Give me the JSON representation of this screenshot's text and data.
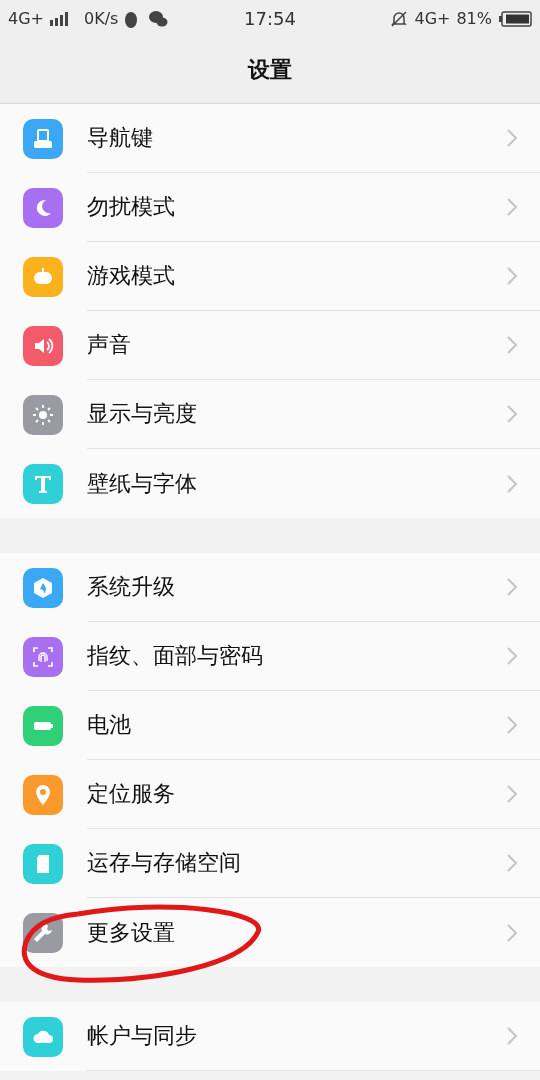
{
  "status_bar": {
    "network": "4G+",
    "speed": "0K/s",
    "time": "17:54",
    "network_right": "4G+",
    "battery": "81%"
  },
  "header": {
    "title": "设置"
  },
  "sections": [
    {
      "items": [
        {
          "label": "导航键",
          "kind": "nav",
          "color": "#3aa8f5",
          "circled": false
        },
        {
          "label": "勿扰模式",
          "kind": "moon",
          "color": "#a86ff0",
          "circled": false
        },
        {
          "label": "游戏模式",
          "kind": "game",
          "color": "#fbb21c",
          "circled": false
        },
        {
          "label": "声音",
          "kind": "sound",
          "color": "#f45b6a",
          "circled": false
        },
        {
          "label": "显示与亮度",
          "kind": "brightness",
          "color": "#9a9aa2",
          "circled": false
        },
        {
          "label": "壁纸与字体",
          "kind": "text",
          "color": "#2fd0d8",
          "circled": false
        }
      ]
    },
    {
      "items": [
        {
          "label": "系统升级",
          "kind": "upgrade",
          "color": "#3aa8f5",
          "circled": false
        },
        {
          "label": "指纹、面部与密码",
          "kind": "fingerprint",
          "color": "#a86ff0",
          "circled": false
        },
        {
          "label": "电池",
          "kind": "battery",
          "color": "#2fd078",
          "circled": false
        },
        {
          "label": "定位服务",
          "kind": "location",
          "color": "#fb9a2c",
          "circled": false
        },
        {
          "label": "运存与存储空间",
          "kind": "storage",
          "color": "#2fd0d8",
          "circled": false
        },
        {
          "label": "更多设置",
          "kind": "wrench",
          "color": "#9a9aa2",
          "circled": true
        }
      ]
    },
    {
      "items": [
        {
          "label": "帐户与同步",
          "kind": "cloud",
          "color": "#2fd0d8",
          "circled": false
        }
      ]
    }
  ]
}
